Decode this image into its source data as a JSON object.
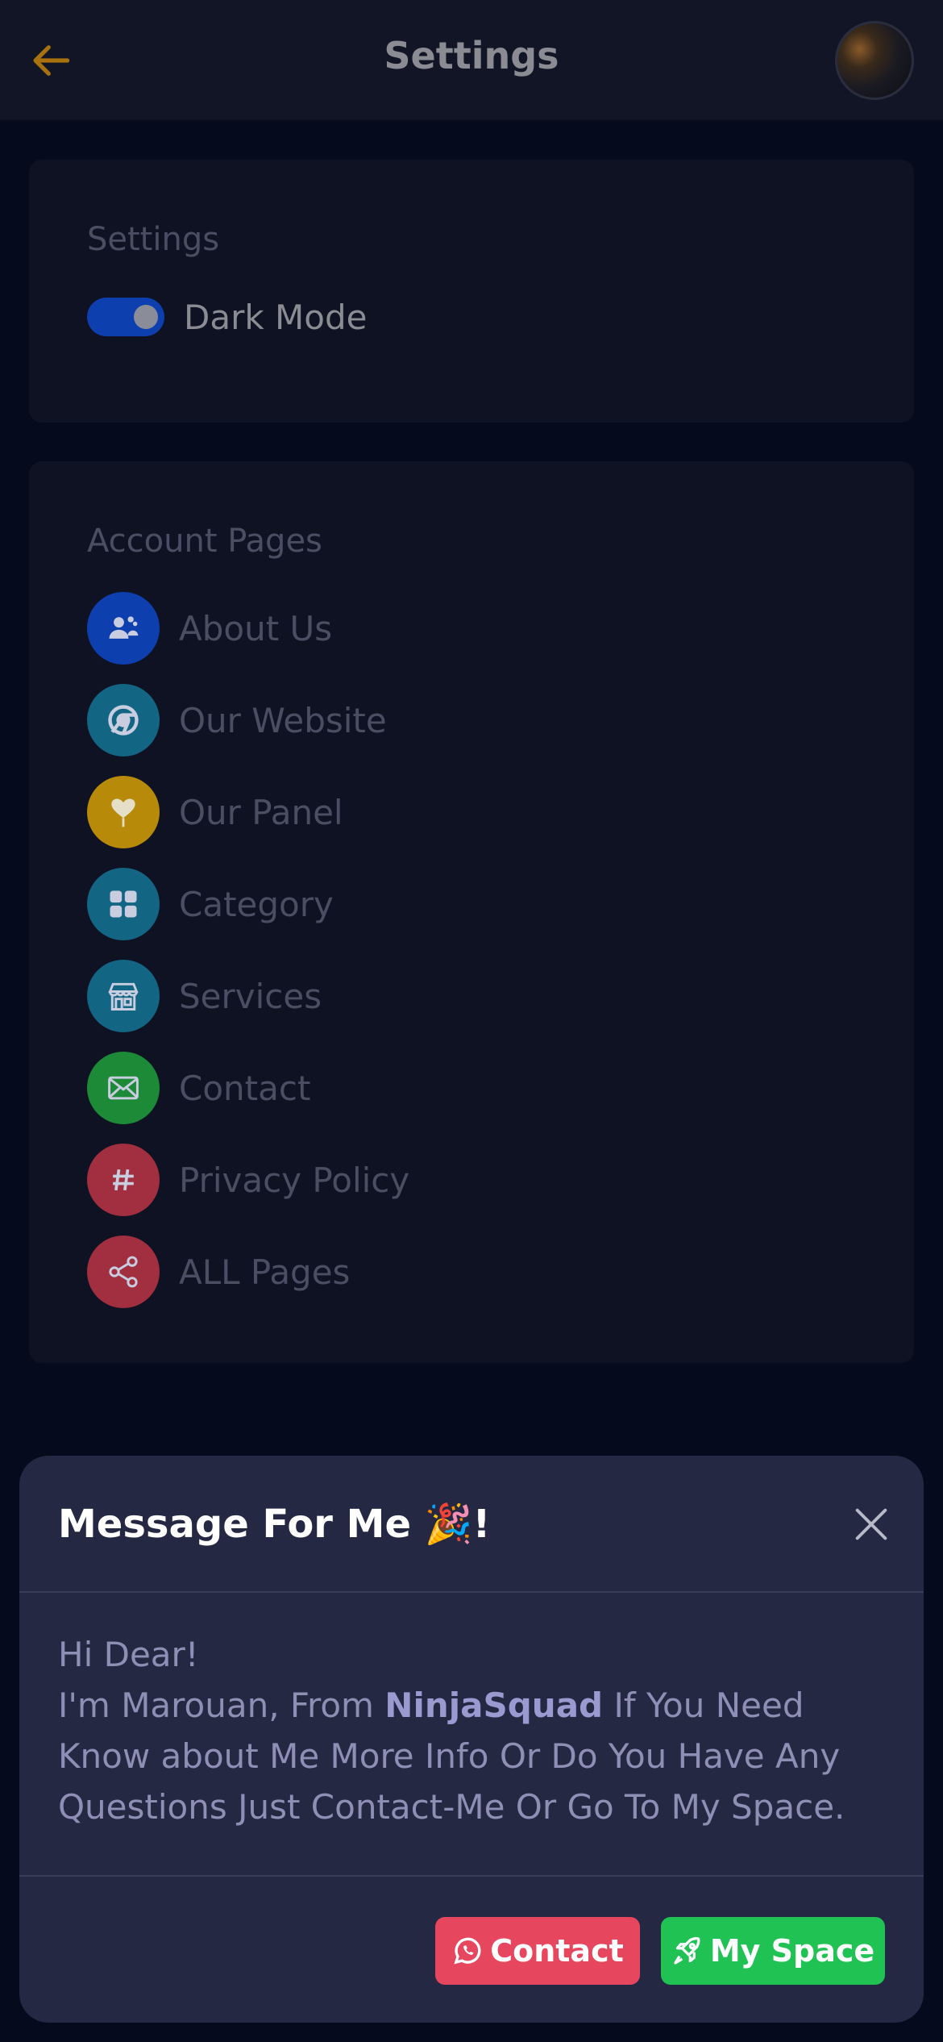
{
  "header": {
    "title": "Settings",
    "back_icon": "arrow-left-icon",
    "accent_color": "#a8720f"
  },
  "settings_card": {
    "heading": "Settings",
    "dark_mode_label": "Dark Mode",
    "dark_mode_on": true
  },
  "pages_card": {
    "heading": "Account Pages",
    "items": [
      {
        "label": "About Us",
        "icon": "users-icon",
        "color": "#0e3fae"
      },
      {
        "label": "Our Website",
        "icon": "chrome-icon",
        "color": "#136584"
      },
      {
        "label": "Our Panel",
        "icon": "heart-balloon-icon",
        "color": "#b88a0a"
      },
      {
        "label": "Category",
        "icon": "grid-icon",
        "color": "#136584"
      },
      {
        "label": "Services",
        "icon": "shop-icon",
        "color": "#136584"
      },
      {
        "label": "Contact",
        "icon": "envelope-icon",
        "color": "#1c8a37"
      },
      {
        "label": "Privacy Policy",
        "icon": "hash-icon",
        "color": "#a12f40"
      },
      {
        "label": "ALL Pages",
        "icon": "share-icon",
        "color": "#a12f40"
      }
    ]
  },
  "modal": {
    "title": "Message For Me 🎉!",
    "greeting": "Hi Dear!",
    "body_prefix": "I'm Marouan, From ",
    "brand": "NinjaSquad",
    "body_suffix": " If You Need Know about Me More Info Or Do You Have Any Questions Just Contact-Me Or Go To My Space.",
    "contact_label": "Contact",
    "space_label": "My Space",
    "contact_color": "#e7475e",
    "space_color": "#20c253"
  }
}
